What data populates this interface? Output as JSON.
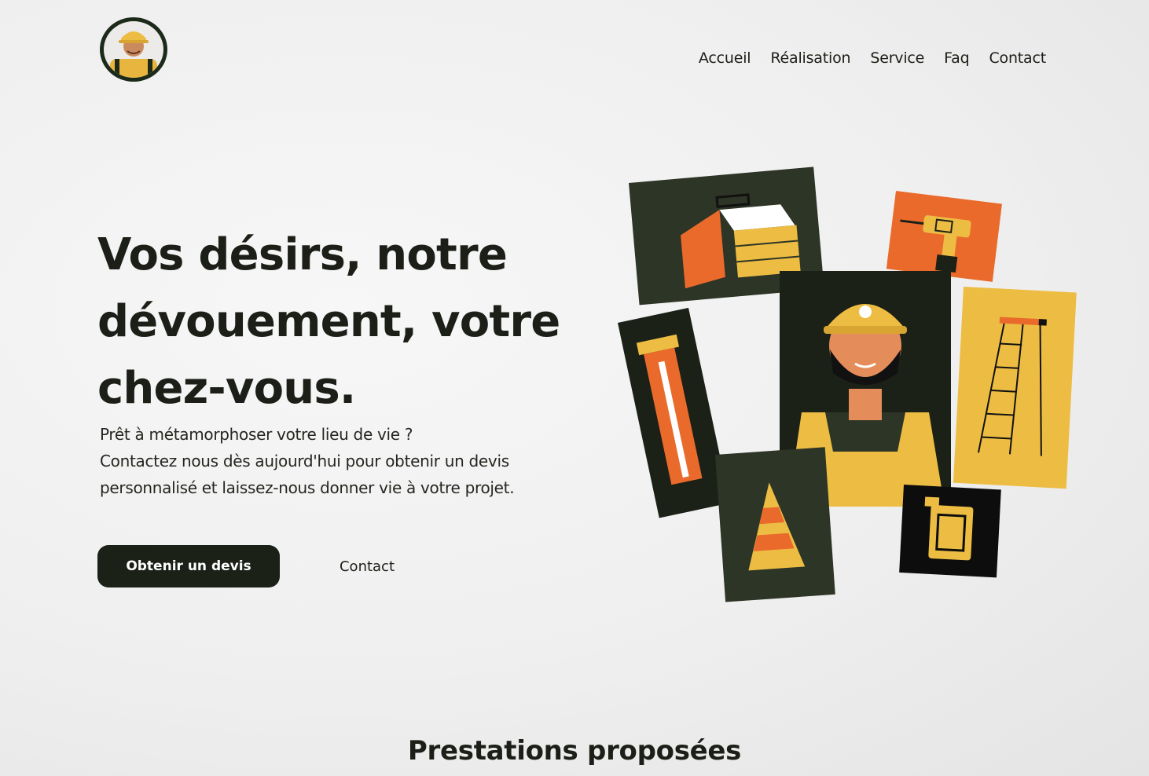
{
  "logo": {
    "icon": "worker-avatar-icon"
  },
  "nav": {
    "items": [
      "Accueil",
      "Réalisation",
      "Service",
      "Faq",
      "Contact"
    ]
  },
  "hero": {
    "title": "Vos désirs, notre dévouement, votre chez-vous.",
    "intro_line1": "Prêt à métamorphoser votre lieu de vie ?",
    "intro_line2": "Contactez nous dès aujourd'hui pour obtenir un devis personnalisé et laissez-nous donner vie à votre projet.",
    "primary_button": "Obtenir un devis",
    "secondary_button": "Contact",
    "illustration_icons": [
      "toolbox-icon",
      "drill-icon",
      "worker-icon",
      "paint-roller-icon",
      "ladder-icon",
      "traffic-cone-icon",
      "jerrycan-icon"
    ]
  },
  "services": {
    "title": "Prestations proposées"
  },
  "colors": {
    "dark": "#1c2118",
    "orange": "#ea6a2c",
    "yellow": "#edbd43",
    "olive": "#2d3526"
  }
}
